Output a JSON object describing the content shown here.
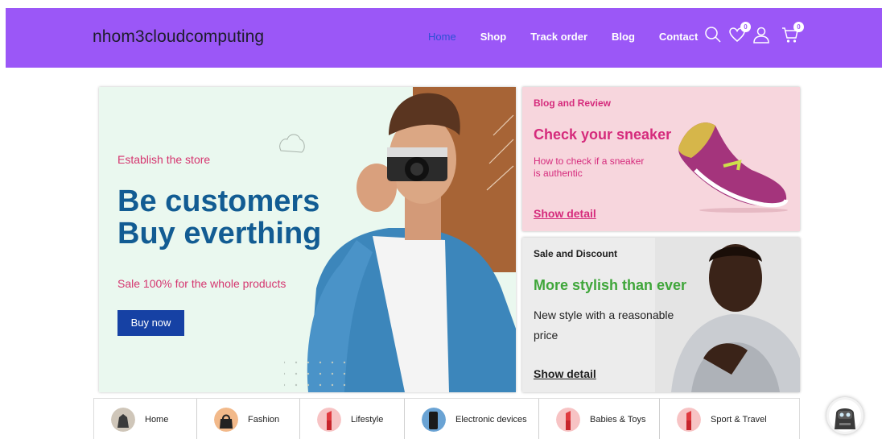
{
  "header": {
    "brand": "nhom3cloudcomputing",
    "nav": [
      {
        "label": "Home",
        "active": true
      },
      {
        "label": "Shop"
      },
      {
        "label": "Track order"
      },
      {
        "label": "Blog"
      },
      {
        "label": "Contact"
      }
    ],
    "wishlist_count": "0",
    "cart_count": "0",
    "icons": [
      "search-icon",
      "heart-icon",
      "user-icon",
      "cart-icon"
    ]
  },
  "hero": {
    "eyebrow": "Establish the store",
    "title_line1": "Be customers",
    "title_line2": "Buy everthing",
    "subtitle": "Sale 100% for the whole products",
    "button": "Buy now"
  },
  "blog_card": {
    "eyebrow": "Blog and Review",
    "title": "Check your sneaker",
    "desc_line1": "How to check if a sneaker",
    "desc_line2": "is authentic",
    "link": "Show detail"
  },
  "sale_card": {
    "eyebrow": "Sale and Discount",
    "title": "More stylish than ever",
    "desc_line1": "New style with a reasonable",
    "desc_line2": "price",
    "link": "Show detail"
  },
  "categories": [
    {
      "label": "Home"
    },
    {
      "label": "Fashion"
    },
    {
      "label": "Lifestyle"
    },
    {
      "label": "Electronic devices"
    },
    {
      "label": "Babies & Toys"
    },
    {
      "label": "Sport & Travel"
    }
  ],
  "colors": {
    "header_bg": "#9b57f7",
    "nav_active": "#2c4fd4",
    "hero_accent": "#d5356f",
    "hero_title": "#125c93",
    "button_bg": "#1641a4",
    "blog_title": "#d52b7c",
    "sale_title": "#3fa63a"
  }
}
